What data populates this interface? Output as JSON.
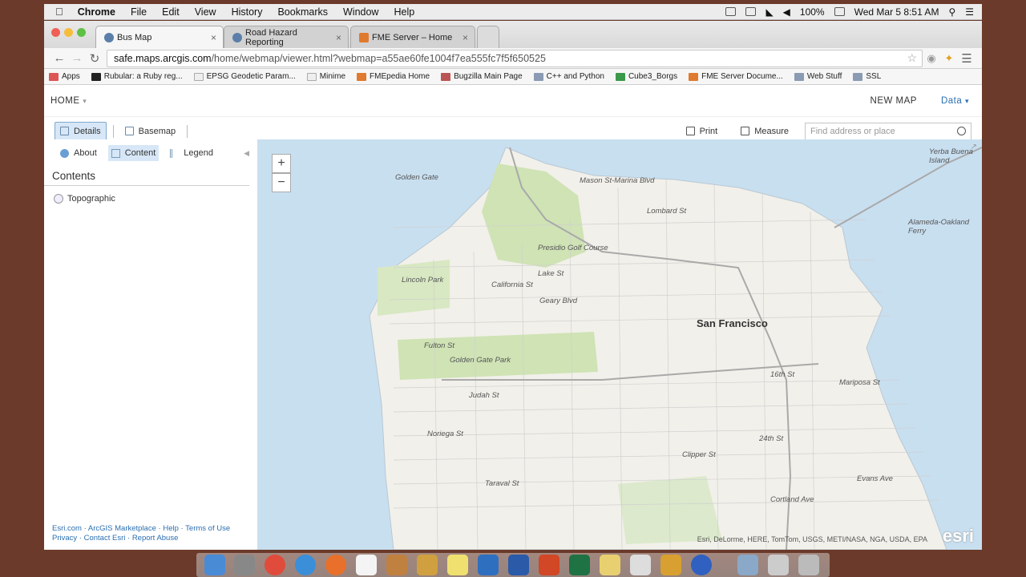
{
  "menubar": {
    "app_name": "Chrome",
    "items": [
      "File",
      "Edit",
      "View",
      "History",
      "Bookmarks",
      "Window",
      "Help"
    ],
    "battery": "100%",
    "datetime": "Wed Mar 5  8:51 AM"
  },
  "tabs": [
    {
      "label": "Bus Map",
      "active": true
    },
    {
      "label": "Road Hazard Reporting",
      "active": false
    },
    {
      "label": "FME Server – Home",
      "active": false
    }
  ],
  "address": {
    "host": "safe.maps.arcgis.com",
    "path": "/home/webmap/viewer.html?webmap=a55ae60fe1004f7ea555fc7f5f650525"
  },
  "bookmarks": [
    {
      "label": "Apps",
      "type": "apps"
    },
    {
      "label": "Rubular: a Ruby reg...",
      "type": "page"
    },
    {
      "label": "EPSG Geodetic Param...",
      "type": "page"
    },
    {
      "label": "Minime",
      "type": "page"
    },
    {
      "label": "FMEpedia Home",
      "type": "page"
    },
    {
      "label": "Bugzilla Main Page",
      "type": "page"
    },
    {
      "label": "C++ and Python",
      "type": "folder"
    },
    {
      "label": "Cube3_Borgs",
      "type": "page"
    },
    {
      "label": "FME Server Docume...",
      "type": "page"
    },
    {
      "label": "Web Stuff",
      "type": "folder"
    },
    {
      "label": "SSL",
      "type": "folder"
    }
  ],
  "header": {
    "home": "HOME",
    "new_map": "NEW MAP",
    "data": "Data"
  },
  "toolbar": {
    "details": "Details",
    "basemap": "Basemap",
    "print": "Print",
    "measure": "Measure",
    "search_placeholder": "Find address or place"
  },
  "panel": {
    "tabs": [
      "About",
      "Content",
      "Legend"
    ],
    "title": "Contents",
    "layer": "Topographic",
    "footer_line1": [
      "Esri.com",
      "ArcGIS Marketplace",
      "Help",
      "Terms of Use"
    ],
    "footer_line2": [
      "Privacy",
      "Contact Esri",
      "Report Abuse"
    ]
  },
  "map": {
    "zoom_in": "+",
    "zoom_out": "−",
    "labels": [
      "Golden Gate",
      "San Francisco",
      "Golden Gate Park",
      "Lincoln Park",
      "Presidio Golf Course",
      "Lake St",
      "California St",
      "Geary Blvd",
      "Fulton St",
      "Judah St",
      "Noriega St",
      "Taraval St",
      "Lombard St",
      "Mariposa St",
      "24th St",
      "Clipper St",
      "Cortland Ave",
      "Evans Ave",
      "Alameda-Oakland Ferry",
      "Yerba Buena Island",
      "16th St",
      "Mason St-Marina Blvd"
    ],
    "attribution": "Esri, DeLorme, HERE, TomTom, USGS, METI/NASA, NGA, USDA, EPA",
    "logo": "esri"
  },
  "colors": {
    "accent": "#2a6fb0",
    "water": "#c8dff0",
    "land": "#f2f0ea",
    "park": "#cfe3b5"
  }
}
